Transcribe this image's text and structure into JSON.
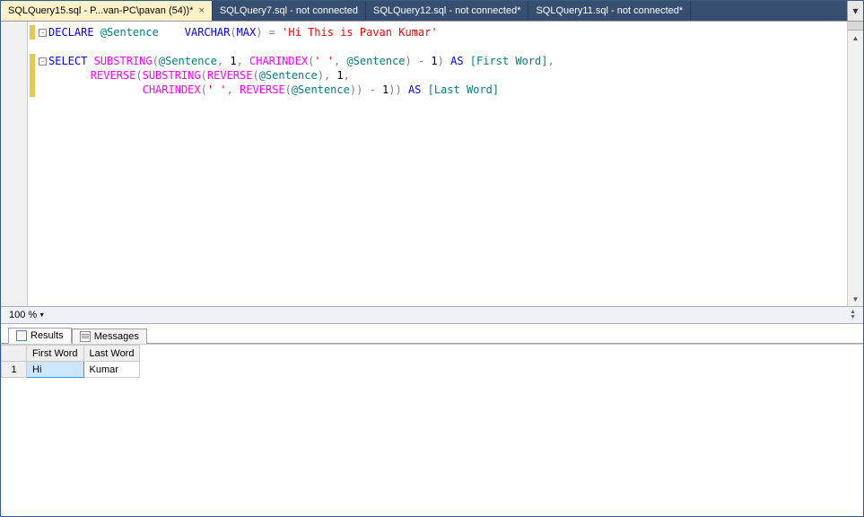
{
  "tabs": [
    {
      "label": "SQLQuery15.sql - P...van-PC\\pavan (54))*",
      "active": true,
      "closeable": true
    },
    {
      "label": "SQLQuery7.sql - not connected",
      "active": false,
      "closeable": false
    },
    {
      "label": "SQLQuery12.sql - not connected*",
      "active": false,
      "closeable": false
    },
    {
      "label": "SQLQuery11.sql - not connected*",
      "active": false,
      "closeable": false
    }
  ],
  "overflow_glyph": "▾",
  "code": {
    "line1": {
      "outline": "-",
      "kw1": "DECLARE",
      "var1": "@Sentence",
      "kw2": "VARCHAR",
      "gray_open": "(",
      "arg": "MAX",
      "gray_close": ")",
      "eq": " = ",
      "str": "'Hi This is Pavan Kumar'"
    },
    "line3": {
      "outline": "-",
      "kw": "SELECT",
      "fn1": "SUBSTRING",
      "open1": "(",
      "var": "@Sentence",
      "comma1": ",",
      "num1": " 1",
      "comma2": ",",
      "fn2": "CHARINDEX",
      "open2": "(",
      "str": "' '",
      "comma3": ",",
      "var2": "@Sentence",
      "close2": ")",
      "minus": " - ",
      "num2": "1",
      "close1": ")",
      "kw_as": "AS",
      "alias": " [First Word]",
      "comma_end": ","
    },
    "line4": {
      "fn1": "REVERSE",
      "open1": "(",
      "fn2": "SUBSTRING",
      "open2": "(",
      "fn3": "REVERSE",
      "open3": "(",
      "var": "@Sentence",
      "close3": ")",
      "comma1": ",",
      "num1": " 1",
      "comma2": ","
    },
    "line5": {
      "fn1": "CHARINDEX",
      "open1": "(",
      "str": "' '",
      "comma1": ",",
      "fn2": "REVERSE",
      "open2": "(",
      "var": "@Sentence",
      "close2": ")",
      "close1": ")",
      "minus": " - ",
      "num": "1",
      "close_outer2": ")",
      "close_outer1": ")",
      "kw_as": "AS",
      "alias": " [Last Word]"
    }
  },
  "zoom": {
    "value": "100 %"
  },
  "result_tabs": {
    "results": "Results",
    "messages": "Messages"
  },
  "grid": {
    "headers": [
      "First Word",
      "Last Word"
    ],
    "rows": [
      {
        "num": "1",
        "cells": [
          "Hi",
          "Kumar"
        ]
      }
    ]
  }
}
